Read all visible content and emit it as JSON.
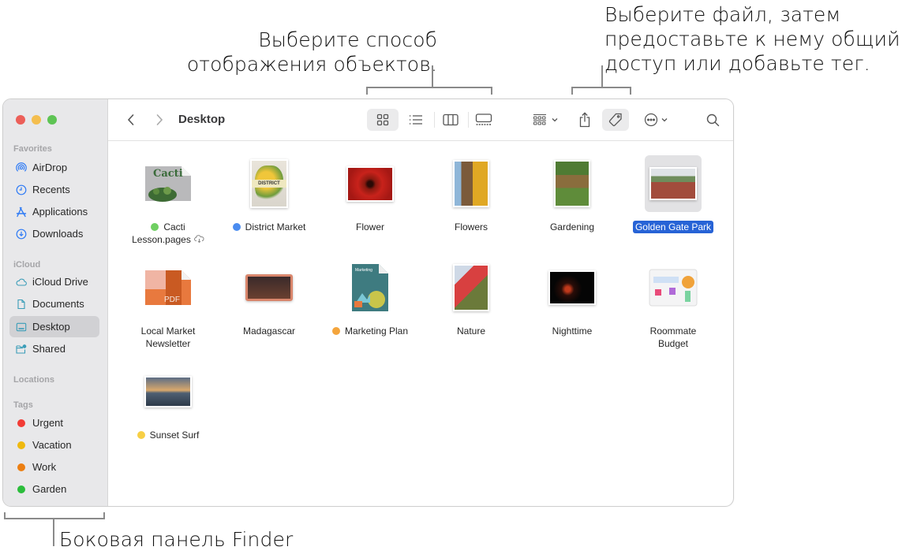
{
  "callouts": {
    "view": [
      "Выберите способ",
      "отображения объектов."
    ],
    "share": [
      "Выберите файл, затем",
      "предоставьте к нему общий",
      "доступ или добавьте тег."
    ],
    "sidebar": "Боковая панель Finder"
  },
  "window": {
    "title": "Desktop"
  },
  "sidebar": {
    "sections": {
      "favorites": "Favorites",
      "icloud": "iCloud",
      "locations": "Locations",
      "tags": "Tags"
    },
    "favorites": [
      {
        "label": "AirDrop",
        "icon": "airdrop-icon"
      },
      {
        "label": "Recents",
        "icon": "clock-icon"
      },
      {
        "label": "Applications",
        "icon": "applications-icon"
      },
      {
        "label": "Downloads",
        "icon": "download-icon"
      }
    ],
    "icloud": [
      {
        "label": "iCloud Drive",
        "icon": "cloud-icon"
      },
      {
        "label": "Documents",
        "icon": "document-icon"
      },
      {
        "label": "Desktop",
        "icon": "desktop-icon",
        "active": true
      },
      {
        "label": "Shared",
        "icon": "shared-folder-icon"
      }
    ],
    "tags": [
      {
        "label": "Urgent",
        "color": "#f23b35"
      },
      {
        "label": "Vacation",
        "color": "#efb90f"
      },
      {
        "label": "Work",
        "color": "#ec7f12"
      },
      {
        "label": "Garden",
        "color": "#2bbd3b"
      }
    ]
  },
  "toolbar": {
    "view_modes": [
      "icon-view",
      "list-view",
      "column-view",
      "gallery-view"
    ],
    "active_view": "icon-view",
    "buttons": [
      "group-by",
      "share",
      "tags",
      "more-actions",
      "search"
    ]
  },
  "files": [
    {
      "name_lines": [
        "Cacti",
        "Lesson.pages"
      ],
      "tag": "#6fcf62",
      "cloud": true
    },
    {
      "name_lines": [
        "District Market"
      ],
      "tag": "#4a8cf0"
    },
    {
      "name_lines": [
        "Flower"
      ]
    },
    {
      "name_lines": [
        "Flowers"
      ]
    },
    {
      "name_lines": [
        "Gardening"
      ]
    },
    {
      "name_lines": [
        "Golden Gate Park"
      ],
      "selected": true
    },
    {
      "name_lines": [
        "Local Market",
        "Newsletter"
      ]
    },
    {
      "name_lines": [
        "Madagascar"
      ]
    },
    {
      "name_lines": [
        "Marketing Plan"
      ],
      "tag": "#f4a53c"
    },
    {
      "name_lines": [
        "Nature"
      ]
    },
    {
      "name_lines": [
        "Nighttime"
      ]
    },
    {
      "name_lines": [
        "Roommate",
        "Budget"
      ]
    },
    {
      "name_lines": [
        "Sunset Surf"
      ],
      "tag": "#f7cf45"
    }
  ],
  "colors": {
    "accent": "#2763d6",
    "sidebar_bg": "#e8e8ea"
  }
}
